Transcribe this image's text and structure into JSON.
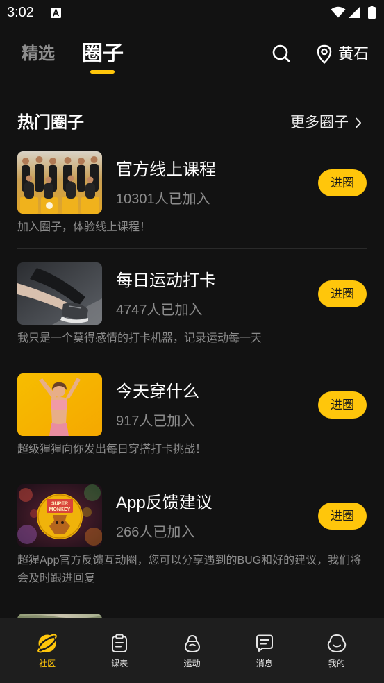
{
  "status_bar": {
    "time": "3:02",
    "icons": [
      "a-notification-icon",
      "wifi-icon",
      "signal-icon",
      "battery-icon"
    ]
  },
  "header": {
    "tabs": [
      {
        "label": "精选",
        "active": false
      },
      {
        "label": "圈子",
        "active": true
      }
    ],
    "search_icon": "search-icon",
    "location_icon": "location-pin-icon",
    "location": "黄石"
  },
  "hot_circles": {
    "title": "热门圈子",
    "more_label": "更多圈子",
    "more_icon": "chevron-right-icon",
    "items": [
      {
        "title": "官方线上课程",
        "members": "10301人已加入",
        "join_label": "进圈",
        "description": "加入圈子，体验线上课程！"
      },
      {
        "title": "每日运动打卡",
        "members": "4747人已加入",
        "join_label": "进圈",
        "description": "我只是一个莫得感情的打卡机器，记录运动每一天"
      },
      {
        "title": "今天穿什么",
        "members": "917人已加入",
        "join_label": "进圈",
        "description": "超级猩猩向你发出每日穿搭打卡挑战！"
      },
      {
        "title": "App反馈建议",
        "members": "266人已加入",
        "join_label": "进圈",
        "description": "超猩App官方反馈互动圈，您可以分享遇到的BUG和好的建议，我们将会及时跟进回复",
        "logo_text": [
          "SUPER",
          "MONKEY"
        ]
      }
    ]
  },
  "bottom_nav": {
    "items": [
      {
        "label": "社区",
        "icon": "community-planet-icon",
        "active": true
      },
      {
        "label": "课表",
        "icon": "clipboard-icon",
        "active": false
      },
      {
        "label": "运动",
        "icon": "kettlebell-icon",
        "active": false
      },
      {
        "label": "消息",
        "icon": "message-bubble-icon",
        "active": false
      },
      {
        "label": "我的",
        "icon": "monkey-profile-icon",
        "active": false
      }
    ]
  },
  "colors": {
    "background": "#121212",
    "accent": "#FFC60B",
    "text_primary": "#FFFFFF",
    "text_secondary": "#8C8C8C",
    "nav_background": "#1E1E1E"
  }
}
